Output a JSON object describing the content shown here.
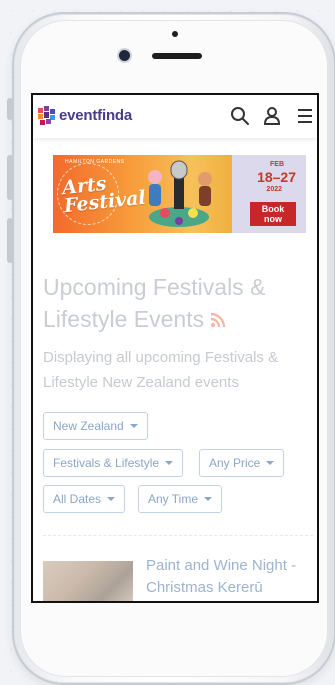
{
  "header": {
    "logo_text": "eventfinda",
    "search_icon": "search-icon",
    "user_icon": "user-icon",
    "menu_icon": "hamburger-menu-icon"
  },
  "banner": {
    "festival_small": "HAMILTON GARDENS",
    "festival_name_line1": "Arts",
    "festival_name_line2": "Festival",
    "month": "FEB",
    "dates": "18–27",
    "year": "2022",
    "cta_line1": "Book",
    "cta_line2": "now"
  },
  "page": {
    "title": "Upcoming Festivals & Lifestyle Events",
    "subtitle": "Displaying all upcoming Festivals & Lifestyle New Zealand events"
  },
  "filters": {
    "location": "New Zealand",
    "category": "Festivals & Lifestyle",
    "price": "Any Price",
    "dates": "All Dates",
    "time": "Any Time"
  },
  "events": [
    {
      "title": "Paint and Wine Night - Christmas Kererū"
    }
  ],
  "colors": {
    "brand": "#4a3c8c",
    "chip_border": "#c2d3e8",
    "chip_text": "#8aa6c8",
    "rss": "#f7b4a0",
    "title": "#c9cdd3"
  }
}
